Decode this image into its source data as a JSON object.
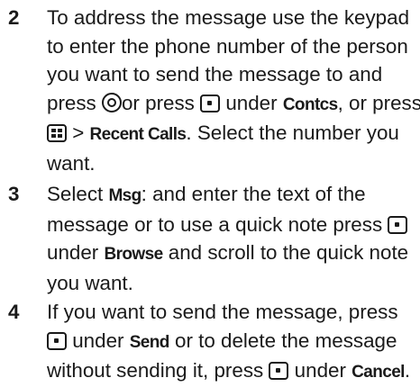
{
  "steps": [
    {
      "number": "2",
      "lines": [
        [
          "To address the message use the keypad"
        ],
        [
          "to enter the phone number of the person"
        ],
        [
          "you want to send the message to and"
        ],
        [
          "press ",
          "@nav",
          "or press ",
          "@softkey",
          " under ",
          "#Contcs",
          ", or press"
        ],
        [
          "@menu",
          " > ",
          "#Recent Calls",
          ". Select the number you"
        ],
        [
          "want."
        ]
      ]
    },
    {
      "number": "3",
      "lines": [
        [
          "Select ",
          "#Msg",
          ": and enter the text of the"
        ],
        [
          "message or to use a quick note press ",
          "@softkey"
        ],
        [
          "under ",
          "#Browse",
          " and scroll to the quick note"
        ],
        [
          "you want."
        ]
      ]
    },
    {
      "number": "4",
      "lines": [
        [
          "If you want to send the message, press"
        ],
        [
          "@softkey",
          " under ",
          "#Send",
          " or to delete the message"
        ],
        [
          "without sending it, press ",
          "@softkey",
          " under ",
          "#Cancel",
          "."
        ]
      ]
    }
  ],
  "icons": {
    "nav": "navigation-key-icon",
    "softkey": "soft-key-icon",
    "menu": "menu-key-icon"
  }
}
